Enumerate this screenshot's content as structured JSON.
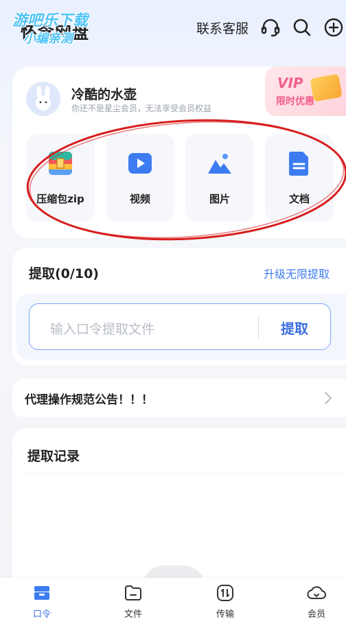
{
  "header": {
    "logo_text": "怀念网盘",
    "watermark_line1": "游吧乐下载",
    "watermark_line2": "小编亲测",
    "service_label": "联系客服",
    "icons": [
      "headset-icon",
      "search-icon",
      "add-icon"
    ]
  },
  "profile": {
    "username": "冷酷的水壶",
    "subtitle": "你还不是星尘会员，无法享受会员权益",
    "vip_title": "VIP",
    "vip_subtitle": "限时优惠"
  },
  "categories": [
    {
      "label": "压缩包zip",
      "icon": "zip-icon"
    },
    {
      "label": "视频",
      "icon": "video-icon"
    },
    {
      "label": "图片",
      "icon": "image-icon"
    },
    {
      "label": "文档",
      "icon": "document-icon"
    }
  ],
  "extract": {
    "title": "提取(0/10)",
    "upgrade_link": "升级无限提取",
    "placeholder": "输入口令提取文件",
    "button": "提取"
  },
  "notice": {
    "text": "代理操作规范公告！！！"
  },
  "records": {
    "title": "提取记录"
  },
  "bottom_nav": [
    {
      "label": "口令",
      "icon": "code-icon",
      "active": true
    },
    {
      "label": "文件",
      "icon": "folder-icon",
      "active": false
    },
    {
      "label": "传输",
      "icon": "transfer-icon",
      "active": false
    },
    {
      "label": "会员",
      "icon": "member-icon",
      "active": false
    }
  ],
  "colors": {
    "accent": "#3d6fe0",
    "link": "#3d7cf0",
    "vip_pink": "#f0618a",
    "annotation_red": "#d81e1e"
  }
}
